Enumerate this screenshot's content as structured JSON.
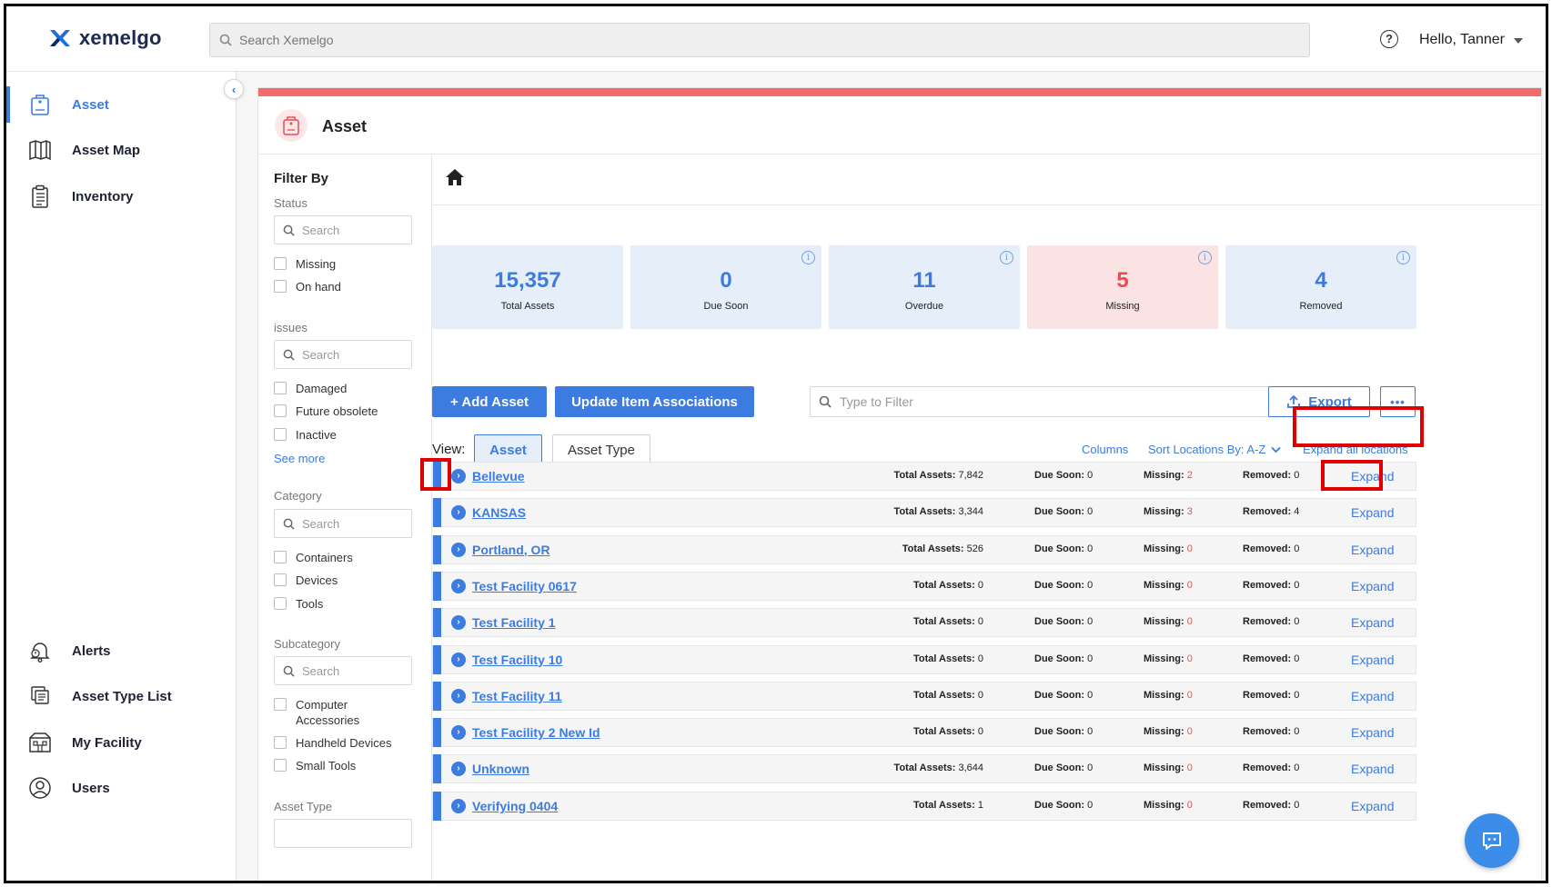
{
  "app": {
    "logo_text": "xemelgo",
    "search_placeholder": "Search Xemelgo",
    "user_greeting": "Hello, Tanner",
    "help_glyph": "?"
  },
  "sidebar": {
    "top_items": [
      {
        "label": "Asset",
        "icon": "asset-tag-icon",
        "active": true
      },
      {
        "label": "Asset Map",
        "icon": "map-icon",
        "active": false
      },
      {
        "label": "Inventory",
        "icon": "clipboard-icon",
        "active": false
      }
    ],
    "bottom_items": [
      {
        "label": "Alerts",
        "icon": "bell-icon"
      },
      {
        "label": "Asset Type List",
        "icon": "asset-type-list-icon"
      },
      {
        "label": "My Facility",
        "icon": "facility-icon"
      },
      {
        "label": "Users",
        "icon": "users-icon"
      }
    ]
  },
  "page": {
    "title": "Asset",
    "accent_bar_color": "#f46b6e"
  },
  "filters": {
    "title": "Filter By",
    "search_placeholder": "Search",
    "see_more": "See more",
    "groups": [
      {
        "label": "Status",
        "options": [
          "Missing",
          "On hand"
        ]
      },
      {
        "label": "issues",
        "options": [
          "Damaged",
          "Future obsolete",
          "Inactive"
        ]
      },
      {
        "label": "Category",
        "options": [
          "Containers",
          "Devices",
          "Tools"
        ]
      },
      {
        "label": "Subcategory",
        "options": [
          "Computer Accessories",
          "Handheld Devices",
          "Small Tools"
        ]
      },
      {
        "label": "Asset Type",
        "options": []
      }
    ]
  },
  "stats": [
    {
      "value": "15,357",
      "label": "Total Assets",
      "info": false,
      "alert": false
    },
    {
      "value": "0",
      "label": "Due Soon",
      "info": true,
      "alert": false
    },
    {
      "value": "11",
      "label": "Overdue",
      "info": true,
      "alert": false
    },
    {
      "value": "5",
      "label": "Missing",
      "info": true,
      "alert": true
    },
    {
      "value": "4",
      "label": "Removed",
      "info": true,
      "alert": false
    }
  ],
  "toolbar": {
    "add_label": "+ Add Asset",
    "update_label": "Update Item Associations",
    "filter_placeholder": "Type to Filter",
    "export_label": "Export",
    "more_label": "•••"
  },
  "view": {
    "label": "View:",
    "options": [
      "Asset",
      "Asset Type"
    ],
    "selected": "Asset",
    "columns_link": "Columns",
    "sort_label": "Sort Locations By: A-Z",
    "expand_all": "Expand all locations"
  },
  "row_labels": {
    "total": "Total Assets:",
    "due": "Due Soon:",
    "missing": "Missing:",
    "removed": "Removed:",
    "expand": "Expand"
  },
  "locations": [
    {
      "name": "Bellevue",
      "total": "7,842",
      "due": "0",
      "missing": "2",
      "removed": "0"
    },
    {
      "name": "KANSAS",
      "total": "3,344",
      "due": "0",
      "missing": "3",
      "removed": "4"
    },
    {
      "name": "Portland, OR",
      "total": "526",
      "due": "0",
      "missing": "0",
      "removed": "0"
    },
    {
      "name": "Test Facility 0617",
      "total": "0",
      "due": "0",
      "missing": "0",
      "removed": "0"
    },
    {
      "name": "Test Facility 1",
      "total": "0",
      "due": "0",
      "missing": "0",
      "removed": "0"
    },
    {
      "name": "Test Facility 10",
      "total": "0",
      "due": "0",
      "missing": "0",
      "removed": "0"
    },
    {
      "name": "Test Facility 11",
      "total": "0",
      "due": "0",
      "missing": "0",
      "removed": "0"
    },
    {
      "name": "Test Facility 2 New Id",
      "total": "0",
      "due": "0",
      "missing": "0",
      "removed": "0"
    },
    {
      "name": "Unknown",
      "total": "3,644",
      "due": "0",
      "missing": "0",
      "removed": "0"
    },
    {
      "name": "Verifying 0404",
      "total": "1",
      "due": "0",
      "missing": "0",
      "removed": "0"
    }
  ],
  "colors": {
    "accent": "#3c7be0",
    "missing_red": "#ee4b51",
    "highlight": "#e00000"
  }
}
